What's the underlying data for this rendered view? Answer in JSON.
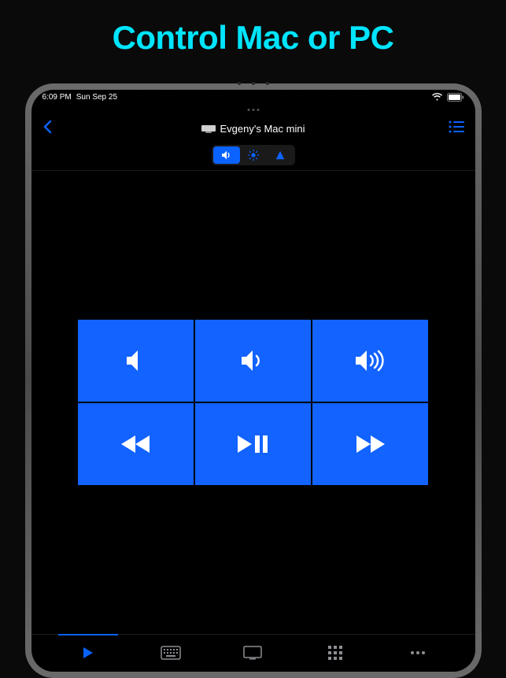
{
  "headline": "Control Mac or PC",
  "status": {
    "time": "6:09 PM",
    "date": "Sun Sep 25"
  },
  "nav": {
    "device_name": "Evgeny's Mac mini"
  },
  "segments": [
    {
      "id": "volume",
      "active": true
    },
    {
      "id": "brightness",
      "active": false
    },
    {
      "id": "navigation",
      "active": false
    }
  ],
  "controls": [
    {
      "id": "mute"
    },
    {
      "id": "volume-down"
    },
    {
      "id": "volume-up"
    },
    {
      "id": "rewind"
    },
    {
      "id": "play-pause"
    },
    {
      "id": "fast-forward"
    }
  ],
  "tabs": [
    {
      "id": "media",
      "active": true
    },
    {
      "id": "keyboard",
      "active": false
    },
    {
      "id": "screen",
      "active": false
    },
    {
      "id": "apps",
      "active": false
    },
    {
      "id": "more",
      "active": false
    }
  ]
}
